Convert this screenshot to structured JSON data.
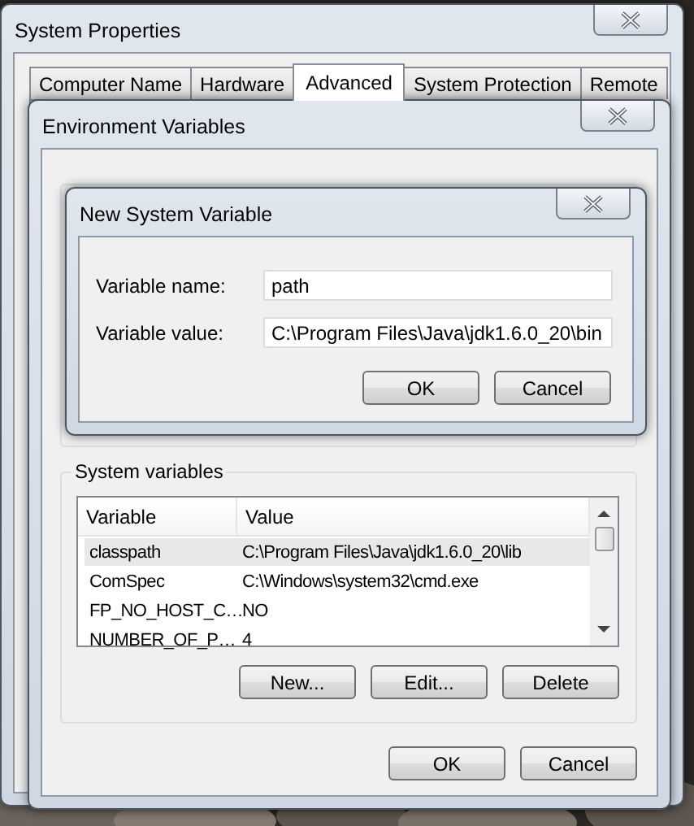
{
  "system_properties": {
    "title": "System Properties",
    "tabs": [
      {
        "label": "Computer Name",
        "selected": false
      },
      {
        "label": "Hardware",
        "selected": false
      },
      {
        "label": "Advanced",
        "selected": true
      },
      {
        "label": "System Protection",
        "selected": false
      },
      {
        "label": "Remote",
        "selected": false
      }
    ]
  },
  "environment_variables": {
    "title": "Environment Variables",
    "system_variables": {
      "label": "System variables",
      "columns": [
        "Variable",
        "Value"
      ],
      "rows": [
        {
          "variable": "classpath",
          "value": "C:\\Program Files\\Java\\jdk1.6.0_20\\lib",
          "selected": true
        },
        {
          "variable": "ComSpec",
          "value": "C:\\Windows\\system32\\cmd.exe",
          "selected": false
        },
        {
          "variable": "FP_NO_HOST_C…",
          "value": "NO",
          "selected": false
        },
        {
          "variable": "NUMBER_OF_P…",
          "value": "4",
          "selected": false
        }
      ],
      "buttons": [
        "New...",
        "Edit...",
        "Delete"
      ]
    },
    "buttons": [
      "OK",
      "Cancel"
    ]
  },
  "new_system_variable": {
    "title": "New System Variable",
    "fields": [
      {
        "label": "Variable name:",
        "value": "path"
      },
      {
        "label": "Variable value:",
        "value": "C:\\Program Files\\Java\\jdk1.6.0_20\\bin"
      }
    ],
    "buttons": [
      "OK",
      "Cancel"
    ]
  }
}
